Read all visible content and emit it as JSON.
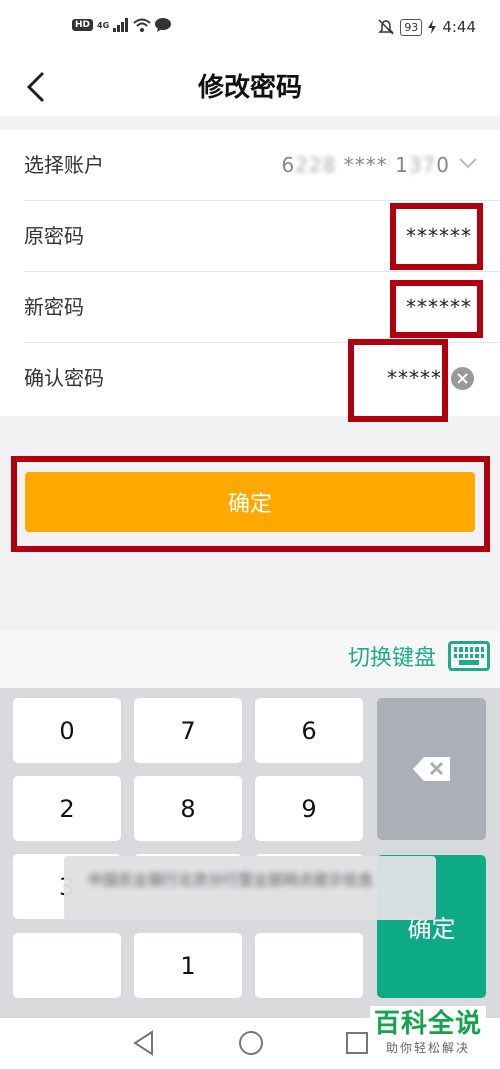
{
  "status_bar": {
    "hd": "HD",
    "network": "4G",
    "battery": "93",
    "time": "4:44"
  },
  "header": {
    "title": "修改密码"
  },
  "form": {
    "account": {
      "label": "选择账户",
      "value_start": "6",
      "value_blur1": "228",
      "value_mid": " **** 1",
      "value_blur2": "37",
      "value_end": "0"
    },
    "old_password": {
      "label": "原密码",
      "value": "******"
    },
    "new_password": {
      "label": "新密码",
      "value": "******"
    },
    "confirm_password": {
      "label": "确认密码",
      "value": "*****"
    }
  },
  "submit_label": "确定",
  "keyboard": {
    "switch_label": "切换键盘",
    "keys": [
      "0",
      "7",
      "6",
      "2",
      "8",
      "9",
      "3",
      "",
      "",
      "",
      "1",
      ""
    ],
    "confirm_label": "确定"
  },
  "toast": {
    "text": "中国农业银行北京分行营业部网点提示信息"
  },
  "watermark": {
    "main": "百科全说",
    "sub": "助你轻松解决"
  },
  "colors": {
    "accent_orange": "#ffa800",
    "keypad_confirm": "#0ea986",
    "highlight_red": "#b00010",
    "switch_green": "#1faa8c"
  }
}
